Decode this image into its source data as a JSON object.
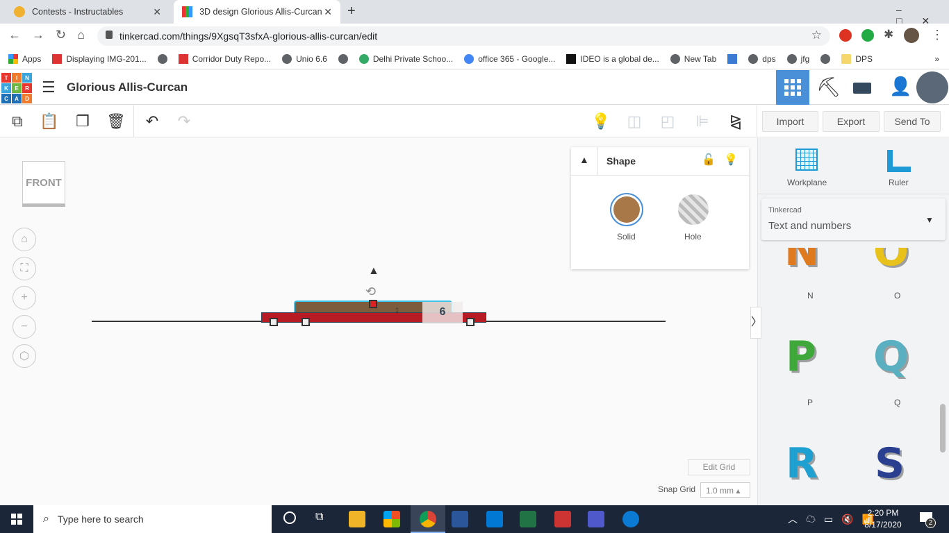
{
  "browser": {
    "tabs": [
      {
        "title": "Contests - Instructables",
        "close": "✕"
      },
      {
        "title": "3D design Glorious Allis-Curcan |",
        "close": "✕"
      }
    ],
    "new_tab": "+",
    "url": "tinkercad.com/things/9XgsqT3sfxA-glorious-allis-curcan/edit",
    "bookmarks": [
      "Apps",
      "Displaying IMG-201...",
      "Corridor Duty Repo...",
      "Unio 6.6",
      "Delhi Private Schoo...",
      "office 365 - Google...",
      "IDEO is a global de...",
      "New Tab",
      "dps",
      "jfg",
      "DPS"
    ],
    "more": "»"
  },
  "app": {
    "logo": [
      "T",
      "I",
      "N",
      "K",
      "E",
      "R",
      "C",
      "A",
      "D"
    ],
    "design_title": "Glorious Allis-Curcan",
    "colors": {
      "accent": "#4a90d9",
      "solid": "#a87848",
      "hole_red": "#b71c24"
    }
  },
  "toolbar": {
    "import": "Import",
    "export": "Export",
    "send_to": "Send To"
  },
  "viewcube": {
    "label": "FRONT"
  },
  "shape_panel": {
    "title": "Shape",
    "solid": "Solid",
    "hole": "Hole"
  },
  "canvas": {
    "dimension": "6",
    "edit_grid": "Edit Grid",
    "snap_grid_label": "Snap Grid",
    "snap_grid_value": "1.0 mm ▴"
  },
  "library": {
    "workplane": "Workplane",
    "ruler": "Ruler",
    "source": "Tinkercad",
    "category": "Text and numbers",
    "shapes": [
      {
        "label": "N",
        "color": "#e07a1f"
      },
      {
        "label": "O",
        "color": "#e8c21a"
      },
      {
        "label": "P",
        "color": "#3fa83a"
      },
      {
        "label": "Q",
        "color": "#5ab0c0"
      },
      {
        "label": "R",
        "color": "#1ea0d0"
      },
      {
        "label": "S",
        "color": "#2a3f8f"
      }
    ]
  },
  "taskbar": {
    "search": "Type here to search",
    "time": "2:20 PM",
    "date": "8/17/2020",
    "notifications": "2"
  }
}
